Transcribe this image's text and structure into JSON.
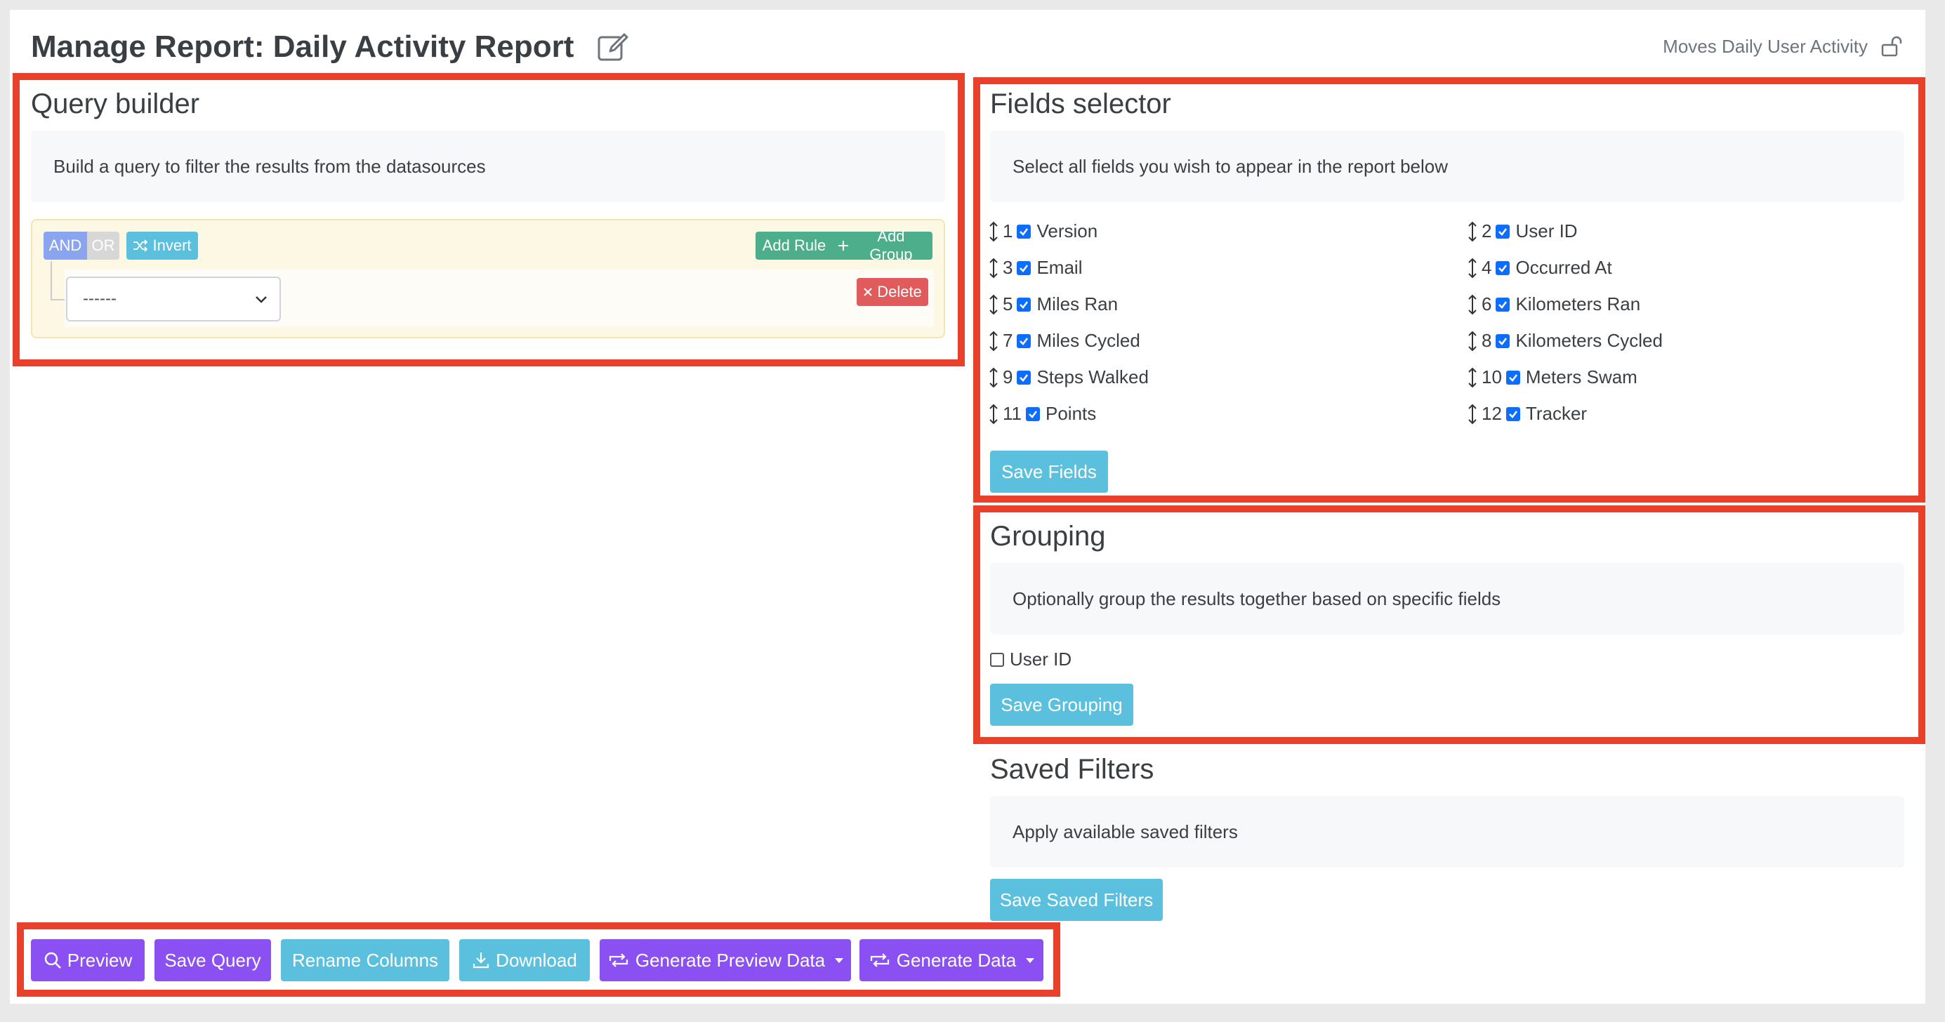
{
  "header": {
    "title": "Manage Report: Daily Activity Report",
    "datasource_link": "Moves Daily User Activity"
  },
  "query_builder": {
    "title": "Query builder",
    "hint": "Build a query to filter the results from the datasources",
    "and_label": "AND",
    "or_label": "OR",
    "invert_label": "Invert",
    "add_rule_label": "Add Rule",
    "add_group_label": "Add Group",
    "delete_label": "Delete",
    "select_value": "------"
  },
  "fields_selector": {
    "title": "Fields selector",
    "hint": "Select all fields you wish to appear in the report below",
    "fields": [
      {
        "num": "1",
        "label": "Version",
        "checked": true
      },
      {
        "num": "2",
        "label": "User ID",
        "checked": true
      },
      {
        "num": "3",
        "label": "Email",
        "checked": true
      },
      {
        "num": "4",
        "label": "Occurred At",
        "checked": true
      },
      {
        "num": "5",
        "label": "Miles Ran",
        "checked": true
      },
      {
        "num": "6",
        "label": "Kilometers Ran",
        "checked": true
      },
      {
        "num": "7",
        "label": "Miles Cycled",
        "checked": true
      },
      {
        "num": "8",
        "label": "Kilometers Cycled",
        "checked": true
      },
      {
        "num": "9",
        "label": "Steps Walked",
        "checked": true
      },
      {
        "num": "10",
        "label": "Meters Swam",
        "checked": true
      },
      {
        "num": "11",
        "label": "Points",
        "checked": true
      },
      {
        "num": "12",
        "label": "Tracker",
        "checked": true
      }
    ],
    "save_label": "Save Fields"
  },
  "grouping": {
    "title": "Grouping",
    "hint": "Optionally group the results together based on specific fields",
    "option_label": "User ID",
    "save_label": "Save Grouping"
  },
  "saved_filters": {
    "title": "Saved Filters",
    "hint": "Apply available saved filters",
    "save_label": "Save Saved Filters"
  },
  "toolbar": {
    "preview_label": "Preview",
    "save_query_label": "Save Query",
    "rename_columns_label": "Rename Columns",
    "download_label": "Download",
    "generate_preview_label": "Generate Preview Data",
    "generate_data_label": "Generate Data"
  },
  "colors": {
    "accent_purple": "#8b50f2",
    "teal": "#5bc0de",
    "highlight_red": "#e8402a",
    "green": "#4cae8a",
    "danger": "#e05c5c"
  }
}
